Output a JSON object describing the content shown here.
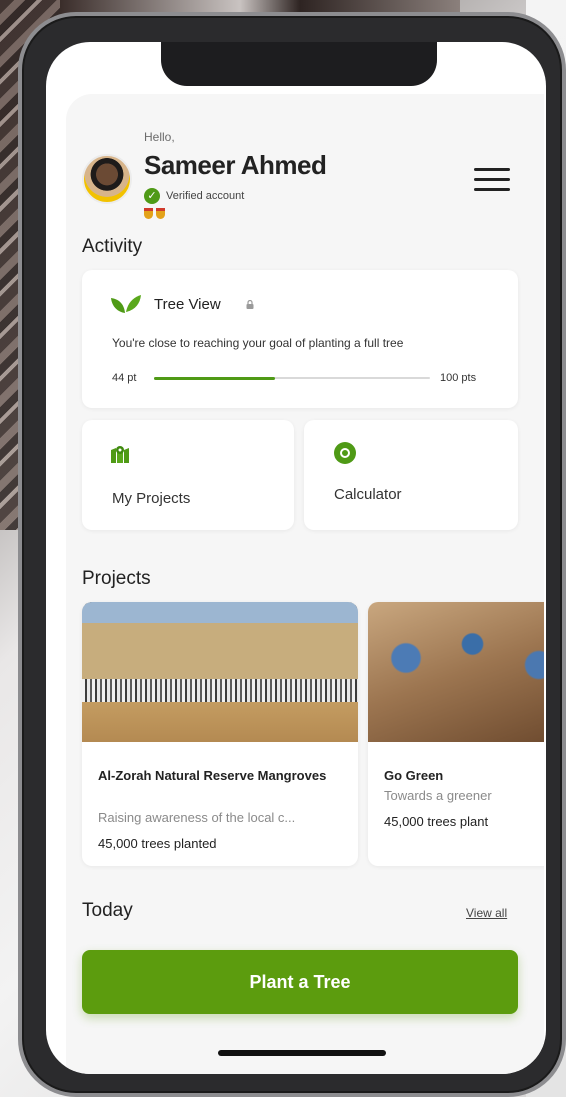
{
  "header": {
    "greeting": "Hello,",
    "user_name": "Sameer Ahmed",
    "verified_label": "Verified account"
  },
  "activity": {
    "title": "Activity",
    "tree_view": {
      "title": "Tree View",
      "description": "You're close to reaching your goal of planting a full tree",
      "progress_start_label": "44 pt",
      "progress_end_label": "100 pts",
      "progress_value": 44,
      "progress_max": 100
    },
    "shortcuts": [
      {
        "label": "My Projects",
        "icon": "map-icon"
      },
      {
        "label": "Calculator",
        "icon": "calculator-icon"
      }
    ]
  },
  "projects": {
    "title": "Projects",
    "items": [
      {
        "title": "Al-Zorah Natural Reserve Mangroves",
        "description": "Raising awareness of the local c...",
        "count": "45,000 trees planted"
      },
      {
        "title": "Go Green",
        "description": "Towards a greener",
        "count": "45,000 trees plant"
      }
    ]
  },
  "today": {
    "title": "Today",
    "view_all_label": "View all"
  },
  "cta": {
    "label": "Plant a Tree"
  },
  "colors": {
    "accent_green": "#5c9c0e",
    "progress_green": "#4f9a16"
  }
}
